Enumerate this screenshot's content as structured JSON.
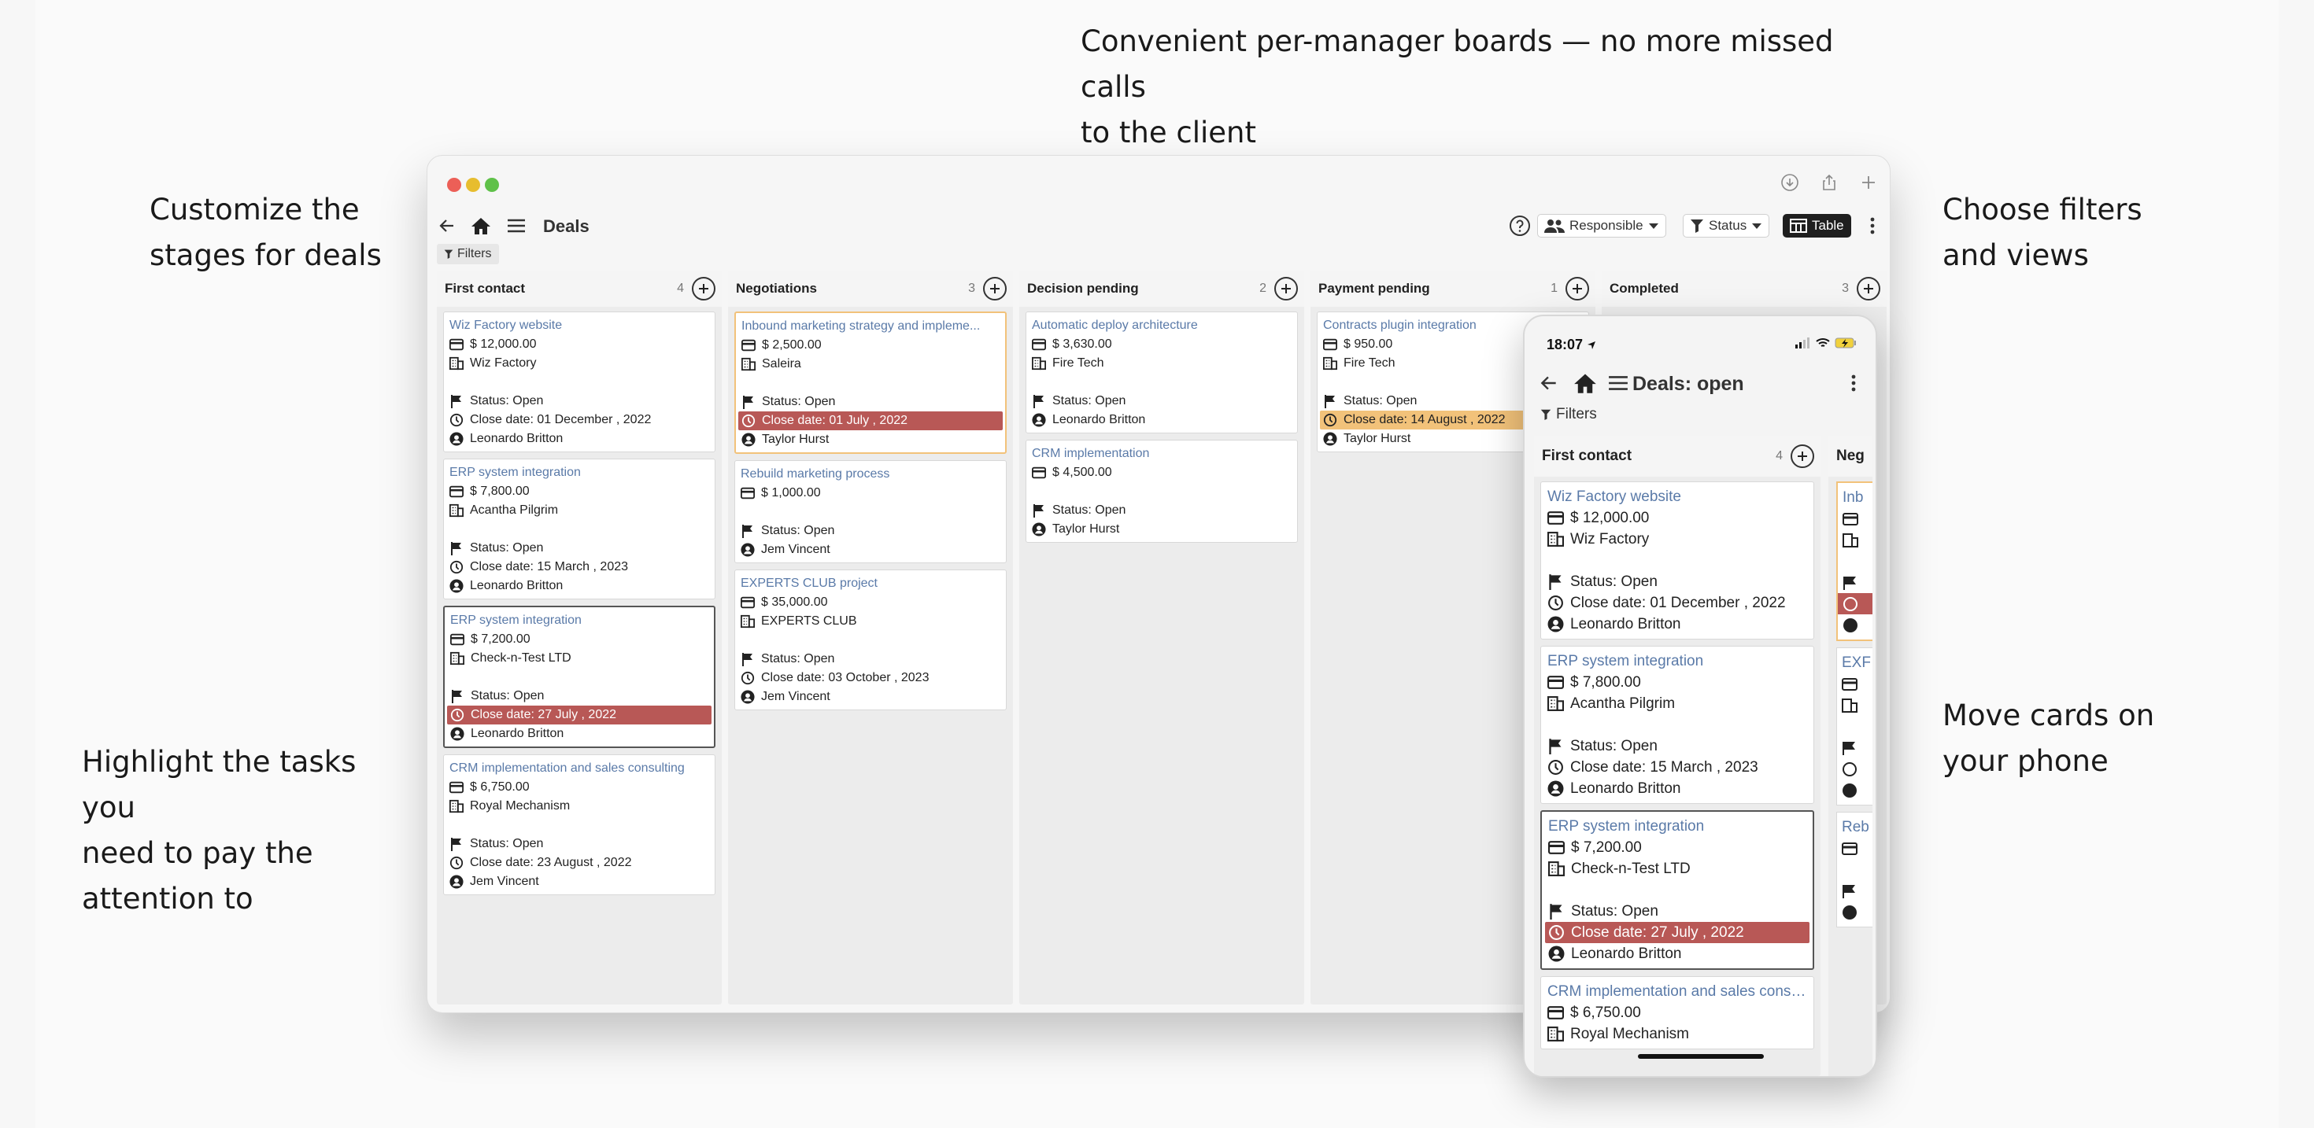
{
  "captions": {
    "top": "Convenient per-manager boards — no more missed calls\nto the client",
    "stages": "Customize the\nstages for deals",
    "filters": "Choose filters\nand views",
    "highlight": "Highlight the tasks you\nneed to pay the\nattention to",
    "phone": "Move cards on\nyour phone"
  },
  "app": {
    "title": "Deals",
    "responsible_label": "Responsible",
    "status_label": "Status",
    "view_label": "Table",
    "filters_label": "Filters"
  },
  "colors": {
    "highlight_red": "#b85856",
    "highlight_orange": "#f2c27a",
    "link_blue": "#5a7aa8"
  },
  "columns": [
    {
      "title": "First contact",
      "count": "4",
      "cards": [
        {
          "title": "Wiz Factory website",
          "amount": "$ 12,000.00",
          "company": "Wiz Factory",
          "status": "Status: Open",
          "close": "Close date: 01 December , 2022",
          "owner": "Leonardo Britton"
        },
        {
          "title": "ERP system integration",
          "amount": "$ 7,800.00",
          "company": "Acantha Pilgrim",
          "status": "Status: Open",
          "close": "Close date: 15 March , 2023",
          "owner": "Leonardo Britton"
        },
        {
          "title": "ERP system integration",
          "amount": "$ 7,200.00",
          "company": "Check-n-Test LTD",
          "status": "Status: Open",
          "close": "Close date: 27 July , 2022",
          "owner": "Leonardo Britton"
        },
        {
          "title": "CRM implementation and sales consulting",
          "amount": "$ 6,750.00",
          "company": "Royal Mechanism",
          "status": "Status: Open",
          "close": "Close date: 23 August , 2022",
          "owner": "Jem Vincent"
        }
      ]
    },
    {
      "title": "Negotiations",
      "count": "3",
      "cards": [
        {
          "title": "Inbound marketing strategy and impleme...",
          "amount": "$ 2,500.00",
          "company": "Saleira",
          "status": "Status: Open",
          "close": "Close date: 01 July , 2022",
          "owner": "Taylor Hurst"
        },
        {
          "title": "Rebuild marketing process",
          "amount": "$ 1,000.00",
          "status": "Status: Open",
          "owner": "Jem Vincent"
        },
        {
          "title": "EXPERTS CLUB project",
          "amount": "$ 35,000.00",
          "company": "EXPERTS CLUB",
          "status": "Status: Open",
          "close": "Close date: 03 October , 2023",
          "owner": "Jem Vincent"
        }
      ]
    },
    {
      "title": "Decision pending",
      "count": "2",
      "cards": [
        {
          "title": "Automatic deploy architecture",
          "amount": "$ 3,630.00",
          "company": "Fire Tech",
          "status": "Status: Open",
          "owner": "Leonardo Britton"
        },
        {
          "title": "CRM implementation",
          "amount": "$ 4,500.00",
          "status": "Status: Open",
          "owner": "Taylor Hurst"
        }
      ]
    },
    {
      "title": "Payment pending",
      "count": "1",
      "cards": [
        {
          "title": "Contracts plugin integration",
          "amount": "$ 950.00",
          "company": "Fire Tech",
          "status": "Status: Open",
          "close": "Close date: 14 August , 2022",
          "owner": "Taylor Hurst"
        }
      ]
    },
    {
      "title": "Completed",
      "count": "3",
      "cards": []
    }
  ],
  "phone": {
    "time": "18:07",
    "title": "Deals: open",
    "filters_label": "Filters",
    "column": {
      "title": "First contact",
      "count": "4",
      "cards": [
        {
          "title": "Wiz Factory website",
          "amount": "$ 12,000.00",
          "company": "Wiz Factory",
          "status": "Status: Open",
          "close": "Close date: 01 December , 2022",
          "owner": "Leonardo Britton"
        },
        {
          "title": "ERP system integration",
          "amount": "$ 7,800.00",
          "company": "Acantha Pilgrim",
          "status": "Status: Open",
          "close": "Close date: 15 March , 2023",
          "owner": "Leonardo Britton"
        },
        {
          "title": "ERP system integration",
          "amount": "$ 7,200.00",
          "company": "Check-n-Test LTD",
          "status": "Status: Open",
          "close": "Close date: 27 July , 2022",
          "owner": "Leonardo Britton"
        },
        {
          "title": "CRM implementation and sales consu...",
          "amount": "$ 6,750.00",
          "company": "Royal Mechanism"
        }
      ]
    },
    "next_column": {
      "title": "Neg",
      "frag1_title": "Inb",
      "frag2_title": "EXF",
      "frag3_title": "Reb"
    }
  }
}
